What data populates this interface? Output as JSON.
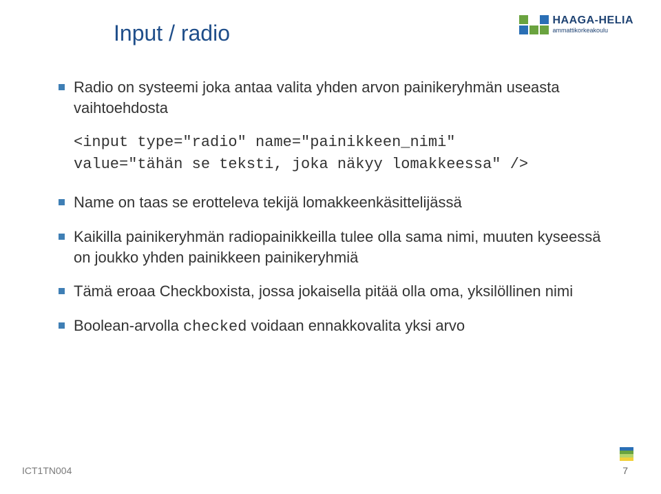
{
  "logo": {
    "brand": "HAAGA-HELIA",
    "tagline": "ammattikorkeakoulu"
  },
  "title": "Input / radio",
  "bullets": {
    "b0": "Radio on systeemi joka antaa valita yhden arvon painikeryhmän useasta vaihtoehdosta",
    "code_line1": "<input type=\"radio\" name=\"painikkeen_nimi\"",
    "code_line2": "value=\"tähän se teksti, joka näkyy lomakkeessa\" />",
    "b1": "Name on taas se erotteleva tekijä lomakkeenkäsittelijässä",
    "b2": "Kaikilla painikeryhmän radiopainikkeilla tulee olla sama nimi, muuten kyseessä on joukko yhden painikkeen painikeryhmiä",
    "b3": "Tämä eroaa Checkboxista, jossa jokaisella pitää olla oma, yksilöllinen nimi",
    "b4_pre": "Boolean-arvolla ",
    "b4_code": "checked",
    "b4_post": " voidaan ennakkovalita yksi arvo"
  },
  "footer": "ICT1TN004",
  "page_number": "7"
}
